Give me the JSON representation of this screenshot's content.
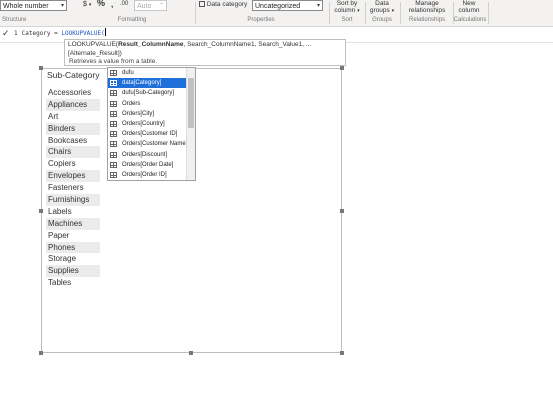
{
  "ribbon": {
    "format_value": "Whole number",
    "structure_label": "Structure",
    "currency_symbol": "$",
    "percent_symbol": "%",
    "comma_symbol": ",",
    "decimal_symbol": ".00",
    "auto_value": "Auto",
    "formatting_label": "Formatting",
    "data_category_label": "Data category",
    "data_category_value": "Uncategorized",
    "properties_label": "Properties",
    "sort_by_column_label": "Sort by column",
    "sort_label": "Sort",
    "data_groups_label": "Data groups",
    "groups_label": "Groups",
    "manage_relationships_label": "Manage relationships",
    "relationships_label": "Relationships",
    "new_column_label": "New column",
    "calculations_label": "Calculations"
  },
  "formula_bar": {
    "check_icon_glyph": "✓",
    "line_number": "1",
    "formula_prefix": "Category = ",
    "formula_function": "LOOKUPVALUE("
  },
  "tooltip": {
    "signature_fn": "LOOKUPVALUE(",
    "signature_bold": "Result_ColumnName",
    "signature_rest": ", Search_ColumnName1, Search_Value1, ...",
    "signature_line2": "[Alternate_Result])",
    "description": "Retrieves a value from a table."
  },
  "autocomplete": {
    "items": [
      {
        "label": "dufu",
        "selected": false
      },
      {
        "label": "data[Category]",
        "selected": true
      },
      {
        "label": "dufu[Sub-Category]",
        "selected": false
      },
      {
        "label": "Orders",
        "selected": false
      },
      {
        "label": "Orders[City]",
        "selected": false
      },
      {
        "label": "Orders[Country]",
        "selected": false
      },
      {
        "label": "Orders[Customer ID]",
        "selected": false
      },
      {
        "label": "Orders[Customer Name]",
        "selected": false
      },
      {
        "label": "Orders[Discount]",
        "selected": false
      },
      {
        "label": "Orders[Order Date]",
        "selected": false
      },
      {
        "label": "Orders[Order ID]",
        "selected": false
      }
    ]
  },
  "slicer": {
    "title": "Sub-Category",
    "items": [
      "Accessories",
      "Appliances",
      "Art",
      "Binders",
      "Bookcases",
      "Chairs",
      "Copiers",
      "Envelopes",
      "Fasteners",
      "Furnishings",
      "Labels",
      "Machines",
      "Paper",
      "Phones",
      "Storage",
      "Supplies",
      "Tables"
    ]
  },
  "colors": {
    "selection_blue": "#1e6fd9",
    "ribbon_bg": "#f3f2f1"
  }
}
